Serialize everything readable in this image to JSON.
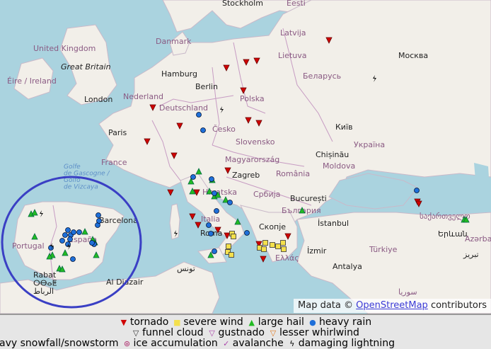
{
  "map": {
    "attribution_prefix": "Map data © ",
    "attribution_link": "OpenStreetMap",
    "attribution_suffix": " contributors",
    "labels": {
      "stockholm": "Stockholm",
      "eesti": "Eesti",
      "latvija": "Latvija",
      "lietuva": "Lietuva",
      "moskva": "Москва",
      "belarus": "Беларусь",
      "danmark": "Danmark",
      "united_kingdom": "United Kingdom",
      "great_britain": "Great Britain",
      "eire": "Éire / Ireland",
      "hamburg": "Hamburg",
      "berlin": "Berlin",
      "nederland": "Nederland",
      "london": "London",
      "polska": "Polska",
      "deutschland": "Deutschland",
      "kyiv": "Київ",
      "paris": "Paris",
      "cesko": "Česko",
      "ukraina": "Україна",
      "slovensko": "Slovensko",
      "chisinau": "Chișinău",
      "moldova": "Moldova",
      "france": "France",
      "magyarorszag": "Magyarország",
      "golfe": "Golfe\nde Gascogne /\nGolfo\nde Vizcaya",
      "zagreb": "Zagreb",
      "romania": "România",
      "hrvatska": "Hrvatska",
      "srbija": "Србија",
      "bucuresti": "București",
      "bulgaria": "България",
      "sakartvelo": "საქართველო",
      "barcelona": "Barcelona",
      "italia": "Italia",
      "skopje": "Скопје",
      "istanbul": "İstanbul",
      "portugal": "Portugal",
      "espana": "España",
      "roma": "Roma",
      "yerevan": "Երևան",
      "azerbaijan": "Azərbaycan",
      "izmir": "İzmir",
      "turkiye": "Türkiye",
      "tabriz": "تبریز",
      "ellas": "Ελλάς",
      "tunis": "تونس",
      "rabat": "Rabat\nⵔⴱⴰⵟ\nالرباط",
      "al_djazair": "Al Djazair",
      "antalya": "Antalya",
      "suriye": "سوريا"
    }
  },
  "legend": {
    "rows": [
      [
        {
          "symbol": "▼",
          "color": "#d00000",
          "label": "tornado"
        },
        {
          "symbol": "■",
          "color": "#f4e04d",
          "label": "severe wind"
        },
        {
          "symbol": "▲",
          "color": "#22bb22",
          "label": "large hail"
        },
        {
          "symbol": "●",
          "color": "#1e6fd9",
          "label": "heavy rain"
        }
      ],
      [
        {
          "symbol": "▽",
          "color": "#333333",
          "label": "funnel cloud"
        },
        {
          "symbol": "▽",
          "color": "#aa44aa",
          "label": "gustnado"
        },
        {
          "symbol": "▽",
          "color": "#e07a20",
          "label": "lesser whirlwind"
        }
      ],
      [
        {
          "symbol": "",
          "color": "#000000",
          "label": "avy snowfall/snowstorm"
        },
        {
          "symbol": "⊛",
          "color": "#b03070",
          "label": "ice accumulation"
        },
        {
          "symbol": "✓",
          "color": "#aa44aa",
          "label": "avalanche"
        },
        {
          "symbol": "ϟ",
          "color": "#000000",
          "label": "damaging lightning"
        }
      ]
    ]
  },
  "markers": {
    "tornado": [
      [
        320,
        96
      ],
      [
        348,
        88
      ],
      [
        363,
        86
      ],
      [
        465,
        57
      ],
      [
        344,
        128
      ],
      [
        216,
        152
      ],
      [
        254,
        178
      ],
      [
        351,
        170
      ],
      [
        366,
        174
      ],
      [
        208,
        200
      ],
      [
        246,
        220
      ],
      [
        322,
        241
      ],
      [
        241,
        272
      ],
      [
        278,
        272
      ],
      [
        272,
        306
      ],
      [
        280,
        318
      ],
      [
        308,
        325
      ],
      [
        321,
        333
      ],
      [
        407,
        334
      ],
      [
        366,
        345
      ],
      [
        372,
        366
      ],
      [
        590,
        285
      ],
      [
        592,
        288
      ]
    ],
    "wind": [
      [
        328,
        330
      ],
      [
        330,
        334
      ],
      [
        323,
        348
      ],
      [
        322,
        356
      ],
      [
        327,
        360
      ],
      [
        367,
        350
      ],
      [
        373,
        352
      ],
      [
        385,
        346
      ],
      [
        393,
        348
      ],
      [
        375,
        343
      ],
      [
        400,
        343
      ],
      [
        401,
        352
      ]
    ],
    "hail": [
      [
        44,
        302
      ],
      [
        49,
        300
      ],
      [
        49,
        334
      ],
      [
        74,
        360
      ],
      [
        70,
        362
      ],
      [
        92,
        357
      ],
      [
        120,
        327
      ],
      [
        134,
        342
      ],
      [
        131,
        338
      ],
      [
        136,
        360
      ],
      [
        84,
        379
      ],
      [
        88,
        380
      ],
      [
        298,
        360
      ],
      [
        270,
        256
      ],
      [
        272,
        270
      ],
      [
        281,
        242
      ],
      [
        296,
        270
      ],
      [
        300,
        254
      ],
      [
        303,
        277
      ],
      [
        308,
        275
      ],
      [
        319,
        282
      ],
      [
        336,
        313
      ],
      [
        427,
        297
      ],
      [
        656,
        310
      ],
      [
        659,
        310
      ]
    ],
    "rain": [
      [
        281,
        162
      ],
      [
        287,
        184
      ],
      [
        273,
        250
      ],
      [
        299,
        253
      ],
      [
        303,
        273
      ],
      [
        325,
        286
      ],
      [
        306,
        298
      ],
      [
        295,
        318
      ],
      [
        298,
        330
      ],
      [
        303,
        355
      ],
      [
        349,
        329
      ],
      [
        92,
        332
      ],
      [
        88,
        340
      ],
      [
        96,
        325
      ],
      [
        100,
        332
      ],
      [
        104,
        328
      ],
      [
        99,
        338
      ],
      [
        96,
        345
      ],
      [
        112,
        328
      ],
      [
        138,
        318
      ],
      [
        140,
        312
      ],
      [
        139,
        304
      ],
      [
        133,
        345
      ],
      [
        130,
        343
      ],
      [
        103,
        366
      ],
      [
        72,
        350
      ],
      [
        589,
        269
      ]
    ],
    "lightning": [
      [
        58,
        302
      ],
      [
        73,
        348
      ],
      [
        97,
        348
      ],
      [
        313,
        155
      ],
      [
        529,
        111
      ],
      [
        248,
        330
      ]
    ]
  }
}
